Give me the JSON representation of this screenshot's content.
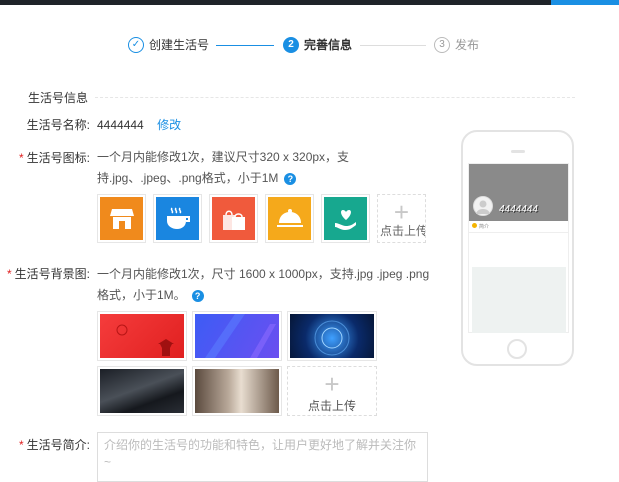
{
  "steps": [
    {
      "num": "✓",
      "label": "创建生活号"
    },
    {
      "num": "2",
      "label": "完善信息"
    },
    {
      "num": "3",
      "label": "发布"
    }
  ],
  "section_title": "生活号信息",
  "name_row": {
    "label": "生活号名称:",
    "value": "4444444",
    "edit": "修改"
  },
  "icon_row": {
    "required": "*",
    "label": "生活号图标:",
    "hint_line1": "一个月内能修改1次，建议尺寸320 x 320px，支",
    "hint_line2": "持.jpg、.jpeg、.png格式，小于1M",
    "help": "?",
    "upload": "点击上传",
    "tiles": [
      {
        "icon": "store-icon",
        "color": "#f08a1c"
      },
      {
        "icon": "coffee-cup-icon",
        "color": "#1a86e0"
      },
      {
        "icon": "shopping-bags-icon",
        "color": "#f05a3c"
      },
      {
        "icon": "food-cloche-icon",
        "color": "#f5a91b"
      },
      {
        "icon": "heart-hand-icon",
        "color": "#17a88f"
      }
    ]
  },
  "bg_row": {
    "required": "*",
    "label": "生活号背景图:",
    "hint_line1": "一个月内能修改1次，尺寸 1600 x 1000px，支持.jpg .jpeg .png",
    "hint_line2": "格式，小于1M。",
    "help": "?",
    "upload": "点击上传"
  },
  "intro_row": {
    "required": "*",
    "label": "生活号简介:",
    "placeholder": "介绍你的生活号的功能和特色，让用户更好地了解并关注你~"
  },
  "preview": {
    "name": "4444444",
    "intro_label": "简介"
  },
  "colors": {
    "accent": "#1a8fe3",
    "required": "#e02020"
  }
}
